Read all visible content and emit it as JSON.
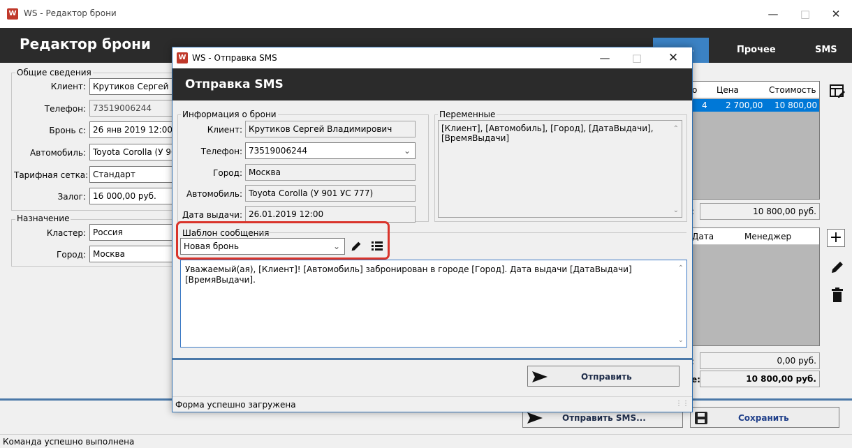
{
  "main_window": {
    "title": "WS - Редактор брони",
    "header": "Редактор брони",
    "tabs": [
      "ь",
      "Прочее",
      "SMS"
    ],
    "general": {
      "title": "Общие сведения",
      "client_label": "Клиент:",
      "client_value": "Крутиков Сергей В",
      "phone_label": "Телефон:",
      "phone_value": "73519006244",
      "booking_label": "Бронь с:",
      "booking_value": "26 янв 2019  12:00",
      "car_label": "Автомобиль:",
      "car_value": "Toyota Corolla (У 90",
      "tariff_label": "Тарифная сетка:",
      "tariff_value": "Стандарт",
      "deposit_label": "Залог:",
      "deposit_value": "16 000,00 руб."
    },
    "purpose": {
      "title": "Назначение",
      "cluster_label": "Кластер:",
      "cluster_value": "Россия",
      "city_label": "Город:",
      "city_value": "Москва"
    },
    "price_table": {
      "headers": [
        "о",
        "Цена",
        "Стоимость"
      ],
      "row": [
        "4",
        "2 700,00",
        "10 800,00"
      ],
      "total_prefix": ":",
      "total": "10 800,00 руб."
    },
    "payments_table": {
      "headers": [
        "Дата",
        "Менеджер"
      ],
      "sum1_prefix": ":",
      "sum1": "0,00 руб.",
      "sum2_prefix": "е:",
      "sum2": "10 800,00 руб."
    },
    "send_sms_button": "Отправить SMS...",
    "save_button": "Сохранить",
    "status": "Команда успешно выполнена"
  },
  "sms_dialog": {
    "title": "WS - Отправка SMS",
    "header": "Отправка SMS",
    "info": {
      "title": "Информация о брони",
      "client_label": "Клиент:",
      "client_value": "Крутиков Сергей Владимирович",
      "phone_label": "Телефон:",
      "phone_value": "73519006244",
      "city_label": "Город:",
      "city_value": "Москва",
      "car_label": "Автомобиль:",
      "car_value": "Toyota Corolla (У 901 УС 777)",
      "date_label": "Дата выдачи:",
      "date_value": "26.01.2019 12:00"
    },
    "variables": {
      "title": "Переменные",
      "text": "[Клиент], [Автомобиль], [Город], [ДатаВыдачи], [ВремяВыдачи]"
    },
    "template": {
      "title": "Шаблон сообщения",
      "value": "Новая бронь"
    },
    "message": "Уважаемый(ая), [Клиент]! [Автомобиль] забронирован в городе [Город]. Дата выдачи [ДатаВыдачи] [ВремяВыдачи].",
    "send_button": "Отправить",
    "status": "Форма успешно загружена"
  },
  "colors": {
    "dark_header": "#2b2b2b",
    "selection": "#0078d7",
    "highlight": "#d9342b",
    "separator": "#4a78a8"
  }
}
